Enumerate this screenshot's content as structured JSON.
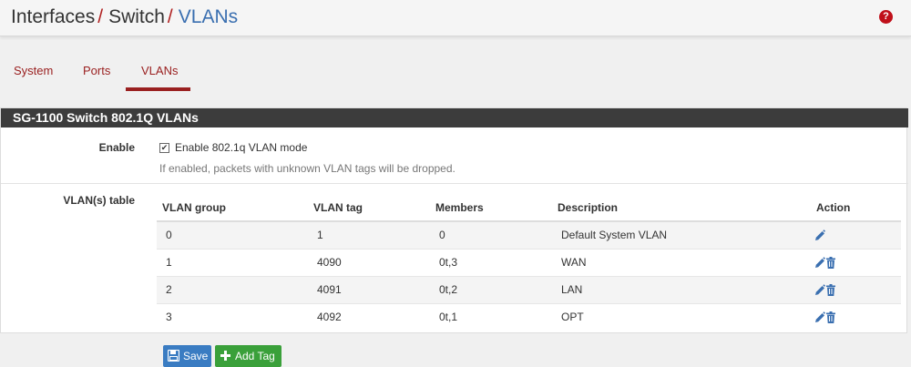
{
  "header": {
    "crumb1": "Interfaces",
    "crumb2": "Switch",
    "crumb3": "VLANs",
    "separator": "/",
    "help_icon": "?"
  },
  "tabs": [
    {
      "label": "System",
      "active": false
    },
    {
      "label": "Ports",
      "active": false
    },
    {
      "label": "VLANs",
      "active": true
    }
  ],
  "panel": {
    "title": "SG-1100 Switch 802.1Q VLANs",
    "enable_label": "Enable",
    "enable_checkbox_label": "Enable 802.1q VLAN mode",
    "enable_checked": true,
    "enable_help": "If enabled, packets with unknown VLAN tags will be dropped.",
    "table_label": "VLAN(s) table"
  },
  "table": {
    "headers": [
      "VLAN group",
      "VLAN tag",
      "Members",
      "Description",
      "Action"
    ],
    "rows": [
      {
        "group": "0",
        "tag": "1",
        "members": "0",
        "description": "Default System VLAN",
        "deletable": false
      },
      {
        "group": "1",
        "tag": "4090",
        "members": "0t,3",
        "description": "WAN",
        "deletable": true
      },
      {
        "group": "2",
        "tag": "4091",
        "members": "0t,2",
        "description": "LAN",
        "deletable": true
      },
      {
        "group": "3",
        "tag": "4092",
        "members": "0t,1",
        "description": "OPT",
        "deletable": true
      }
    ]
  },
  "buttons": {
    "save": "Save",
    "add_tag": "Add Tag"
  },
  "colors": {
    "accent_red": "#9a2020",
    "link_blue": "#3a6fb0",
    "save_blue": "#3a7cc2",
    "add_green": "#3aa03a",
    "panel_heading": "#3c3c3c"
  }
}
